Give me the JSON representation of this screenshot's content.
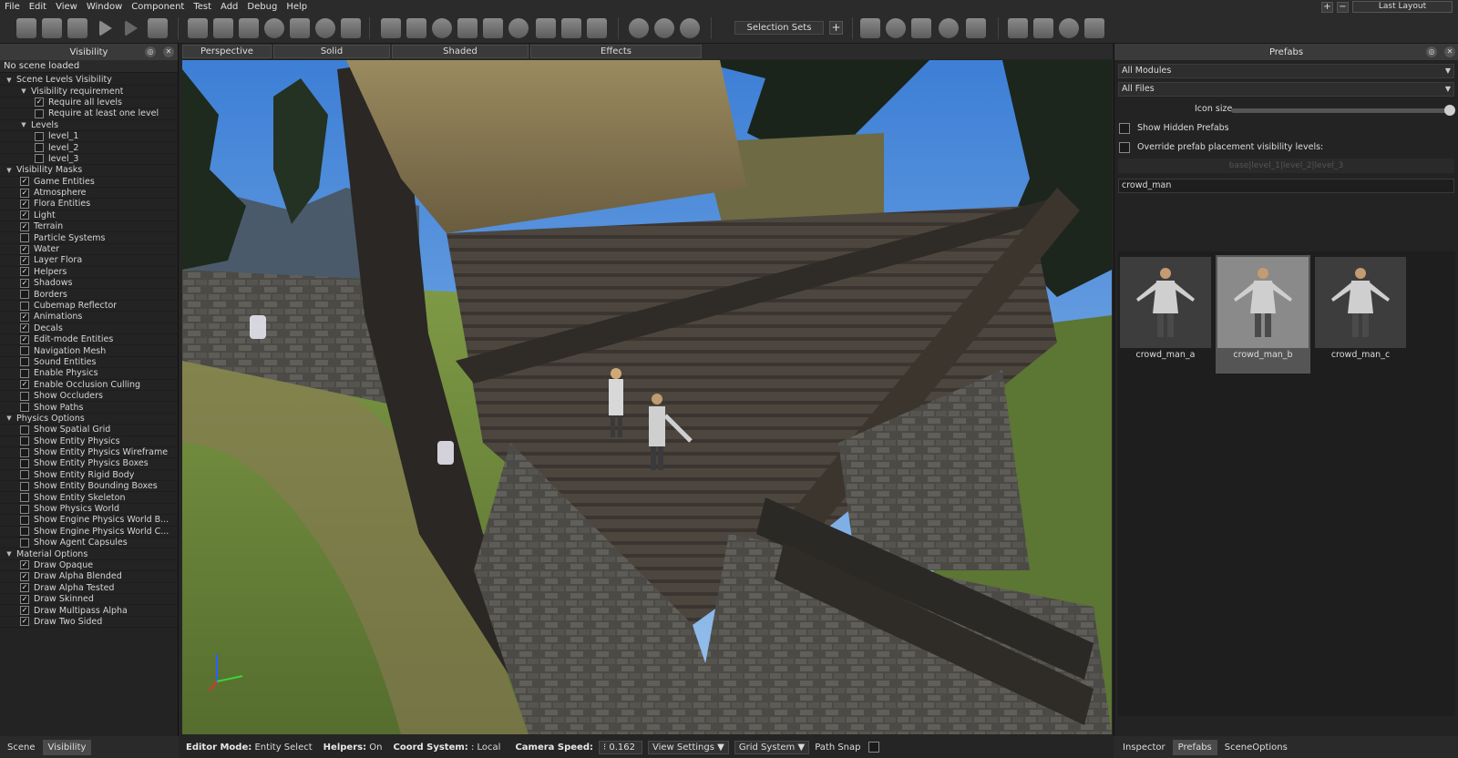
{
  "menu": [
    "File",
    "Edit",
    "View",
    "Window",
    "Component",
    "Test",
    "Add",
    "Debug",
    "Help"
  ],
  "layout": {
    "current": "Last Layout",
    "add_label": "+",
    "remove_label": "−"
  },
  "toolbar": {
    "selection_sets_label": "Selection Sets",
    "add_label": "+"
  },
  "left_panel": {
    "title": "Visibility",
    "status": "No scene loaded",
    "tree": [
      {
        "label": "Scene Levels Visibility",
        "level": 0,
        "expandable": true
      },
      {
        "label": "Visibility requirement",
        "level": 1,
        "expandable": true
      },
      {
        "label": "Require all levels",
        "level": 2,
        "checked": true
      },
      {
        "label": "Require at least one level",
        "level": 2,
        "checked": false
      },
      {
        "label": "Levels",
        "level": 1,
        "expandable": true
      },
      {
        "label": "level_1",
        "level": 2,
        "checked": false
      },
      {
        "label": "level_2",
        "level": 2,
        "checked": false
      },
      {
        "label": "level_3",
        "level": 2,
        "checked": false
      },
      {
        "label": "Visibility Masks",
        "level": 0,
        "expandable": true
      },
      {
        "label": "Game Entities",
        "level": 1,
        "checked": true
      },
      {
        "label": "Atmosphere",
        "level": 1,
        "checked": true
      },
      {
        "label": "Flora Entities",
        "level": 1,
        "checked": true
      },
      {
        "label": "Light",
        "level": 1,
        "checked": true
      },
      {
        "label": "Terrain",
        "level": 1,
        "checked": true
      },
      {
        "label": "Particle Systems",
        "level": 1,
        "checked": false
      },
      {
        "label": "Water",
        "level": 1,
        "checked": true
      },
      {
        "label": "Layer Flora",
        "level": 1,
        "checked": true
      },
      {
        "label": "Helpers",
        "level": 1,
        "checked": true
      },
      {
        "label": "Shadows",
        "level": 1,
        "checked": true
      },
      {
        "label": "Borders",
        "level": 1,
        "checked": false
      },
      {
        "label": "Cubemap Reflector",
        "level": 1,
        "checked": false
      },
      {
        "label": "Animations",
        "level": 1,
        "checked": true
      },
      {
        "label": "Decals",
        "level": 1,
        "checked": true
      },
      {
        "label": "Edit-mode Entities",
        "level": 1,
        "checked": true
      },
      {
        "label": "Navigation Mesh",
        "level": 1,
        "checked": false
      },
      {
        "label": "Sound Entities",
        "level": 1,
        "checked": false
      },
      {
        "label": "Enable Physics",
        "level": 1,
        "checked": false
      },
      {
        "label": "Enable Occlusion Culling",
        "level": 1,
        "checked": true
      },
      {
        "label": "Show Occluders",
        "level": 1,
        "checked": false
      },
      {
        "label": "Show Paths",
        "level": 1,
        "checked": false
      },
      {
        "label": "Physics Options",
        "level": 0,
        "expandable": true
      },
      {
        "label": "Show Spatial Grid",
        "level": 1,
        "checked": false
      },
      {
        "label": "Show Entity Physics",
        "level": 1,
        "checked": false
      },
      {
        "label": "Show Entity Physics Wireframe",
        "level": 1,
        "checked": false
      },
      {
        "label": "Show Entity Physics Boxes",
        "level": 1,
        "checked": false
      },
      {
        "label": "Show Entity Rigid Body",
        "level": 1,
        "checked": false
      },
      {
        "label": "Show Entity Bounding Boxes",
        "level": 1,
        "checked": false
      },
      {
        "label": "Show Entity Skeleton",
        "level": 1,
        "checked": false
      },
      {
        "label": "Show Physics World",
        "level": 1,
        "checked": false
      },
      {
        "label": "Show Engine Physics World B...",
        "level": 1,
        "checked": false
      },
      {
        "label": "Show Engine Physics World C...",
        "level": 1,
        "checked": false
      },
      {
        "label": "Show Agent Capsules",
        "level": 1,
        "checked": false
      },
      {
        "label": "Material Options",
        "level": 0,
        "expandable": true
      },
      {
        "label": "Draw Opaque",
        "level": 1,
        "checked": true
      },
      {
        "label": "Draw Alpha Blended",
        "level": 1,
        "checked": true
      },
      {
        "label": "Draw Alpha Tested",
        "level": 1,
        "checked": true
      },
      {
        "label": "Draw Skinned",
        "level": 1,
        "checked": true
      },
      {
        "label": "Draw Multipass Alpha",
        "level": 1,
        "checked": true
      },
      {
        "label": "Draw Two Sided",
        "level": 1,
        "checked": true
      }
    ],
    "bottom_tabs": [
      {
        "label": "Scene",
        "active": false
      },
      {
        "label": "Visibility",
        "active": true
      }
    ]
  },
  "viewport": {
    "tabs": [
      "Perspective",
      "Solid",
      "Shaded",
      "Effects"
    ]
  },
  "statusbar": {
    "editor_mode_label": "Editor Mode:",
    "editor_mode_value": "Entity Select",
    "helpers_label": "Helpers:",
    "helpers_value": "On",
    "coord_label": "Coord System:",
    "coord_value": ": Local",
    "camera_speed_label": "Camera Speed:",
    "camera_speed_value": "0.162",
    "view_settings": "View Settings",
    "grid_system": "Grid System",
    "path_snap": "Path Snap"
  },
  "right_panel": {
    "title": "Prefabs",
    "modules_select": "All Modules",
    "files_select": "All Files",
    "icon_size_label": "Icon size",
    "icon_size_value": 1.0,
    "show_hidden_label": "Show Hidden Prefabs",
    "override_label": "Override prefab placement visibility levels:",
    "visibility_levels": "base|level_1|level_2|level_3",
    "search_value": "crowd_man",
    "items": [
      {
        "name": "crowd_man_a",
        "selected": false
      },
      {
        "name": "crowd_man_b",
        "selected": true
      },
      {
        "name": "crowd_man_c",
        "selected": false
      }
    ],
    "bottom_tabs": [
      {
        "label": "Inspector",
        "active": false
      },
      {
        "label": "Prefabs",
        "active": true
      },
      {
        "label": "SceneOptions",
        "active": false
      }
    ]
  },
  "icons": {
    "close": "close-icon",
    "expand": "triangle-down-icon",
    "check": "✓"
  }
}
